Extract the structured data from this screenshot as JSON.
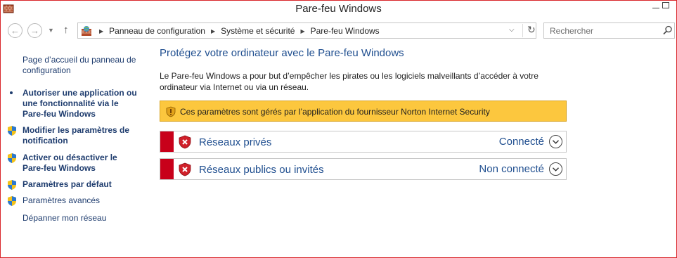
{
  "window": {
    "title": "Pare-feu Windows",
    "accent_border": "#d9262a"
  },
  "navigation": {
    "back_icon": "back-arrow-icon",
    "forward_icon": "forward-arrow-icon",
    "recent_icon": "chevron-down-icon",
    "up_icon": "up-arrow-icon",
    "breadcrumbs": [
      "Panneau de configuration",
      "Système et sécurité",
      "Pare-feu Windows"
    ],
    "search_placeholder": "Rechercher"
  },
  "sidebar": {
    "items": [
      {
        "label": "Page d’accueil du panneau de configuration",
        "icon": null,
        "bold": false
      },
      {
        "label": "Autoriser une application ou une fonctionnalité via le Pare-feu Windows",
        "icon": "bullet",
        "bold": true
      },
      {
        "label": "Modifier les paramètres de notification",
        "icon": "shield-icon",
        "bold": true
      },
      {
        "label": "Activer ou désactiver le Pare-feu Windows",
        "icon": "shield-icon",
        "bold": true
      },
      {
        "label": "Paramètres par défaut",
        "icon": "shield-icon",
        "bold": true
      },
      {
        "label": "Paramètres avancés",
        "icon": "shield-icon",
        "bold": false
      },
      {
        "label": "Dépanner mon réseau",
        "icon": null,
        "bold": false
      }
    ]
  },
  "main": {
    "title": "Protégez votre ordinateur avec le Pare-feu Windows",
    "description": "Le Pare-feu Windows a pour but d’empêcher les pirates ou les logiciels malveillants d’accéder à votre ordinateur via Internet ou via un réseau.",
    "warning": {
      "text": "Ces paramètres sont gérés par l’application du fournisseur Norton Internet Security",
      "color": "#fcc73e"
    },
    "networks": [
      {
        "label": "Réseaux privés",
        "status": "Connecté",
        "status_color": "#c8001a"
      },
      {
        "label": "Réseaux publics ou invités",
        "status": "Non connecté",
        "status_color": "#c8001a"
      }
    ]
  }
}
